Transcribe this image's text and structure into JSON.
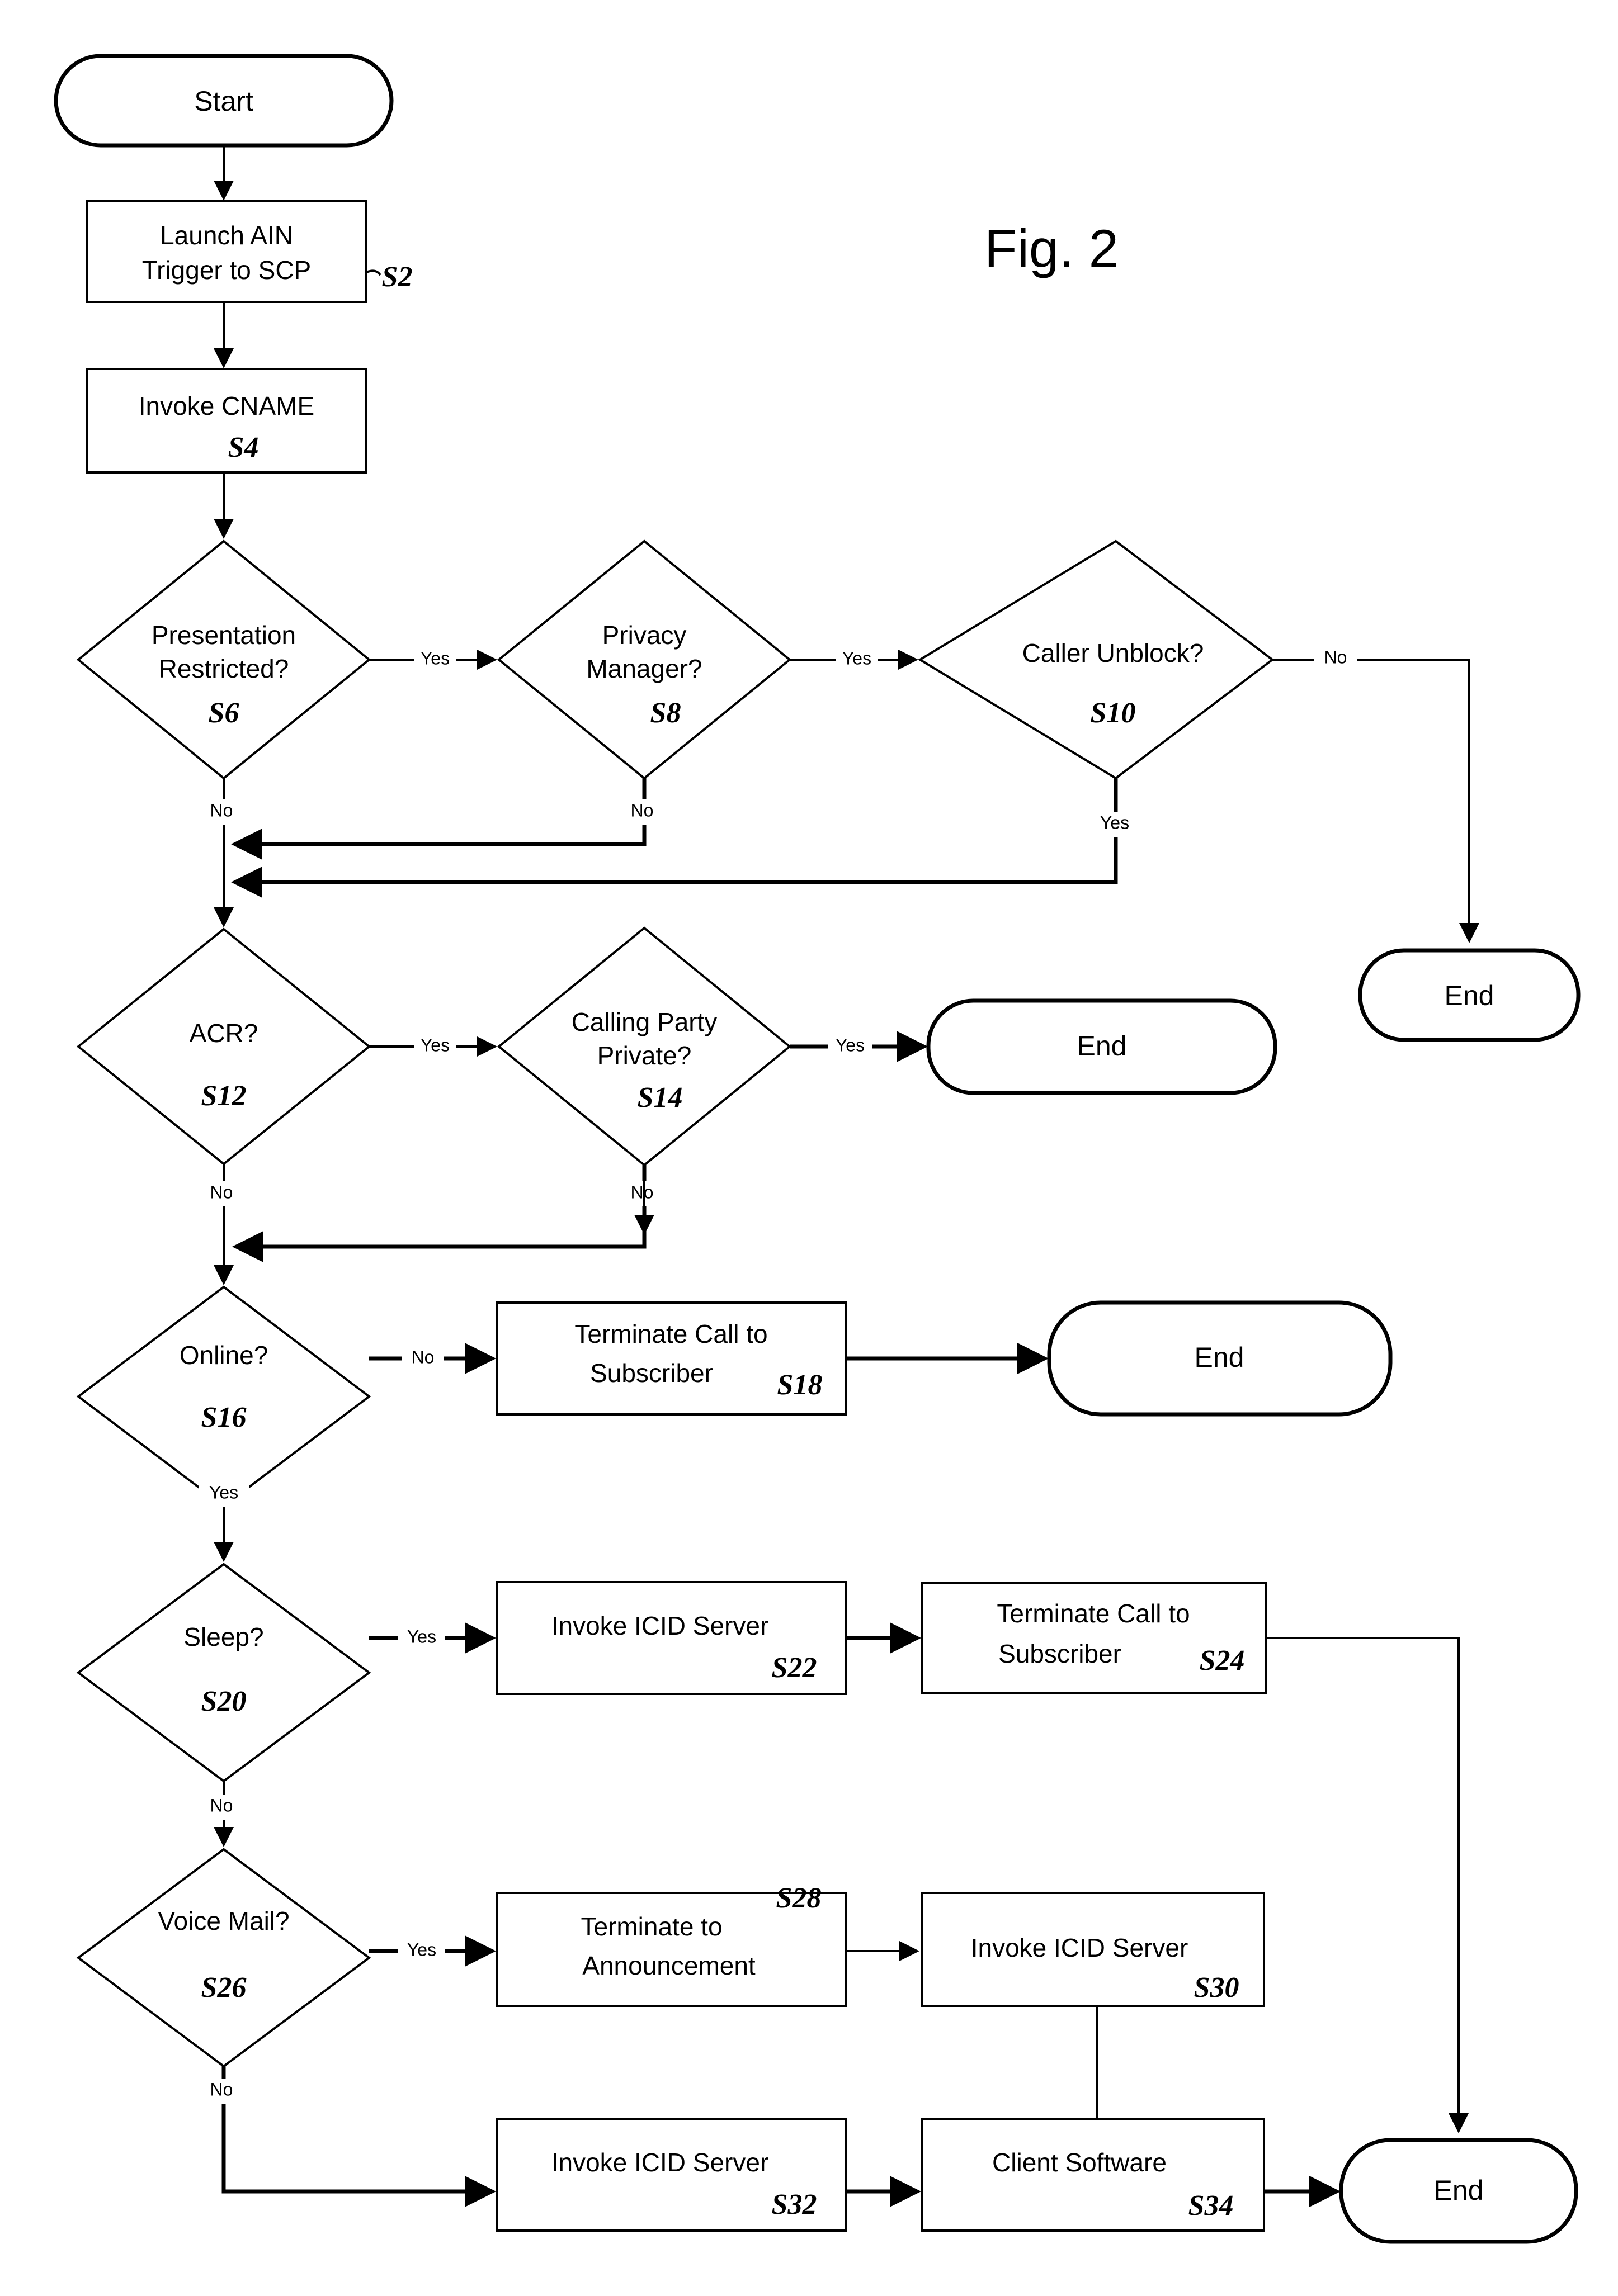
{
  "figure": {
    "title": "Fig. 2",
    "type": "patent-flowchart"
  },
  "nodes": {
    "start": {
      "label": "Start",
      "shape": "terminator",
      "ref": ""
    },
    "s2": {
      "label_line1": "Launch AIN",
      "label_line2": "Trigger to SCP",
      "shape": "process",
      "ref": "S2"
    },
    "s4": {
      "label_line1": "Invoke CNAME",
      "label_line2": "",
      "shape": "process",
      "ref": "S4"
    },
    "s6": {
      "label_line1": "Presentation",
      "label_line2": "Restricted?",
      "shape": "decision",
      "ref": "S6"
    },
    "s8": {
      "label_line1": "Privacy",
      "label_line2": "Manager?",
      "shape": "decision",
      "ref": "S8"
    },
    "s10": {
      "label_line1": "Caller Unblock?",
      "label_line2": "",
      "shape": "decision",
      "ref": "S10"
    },
    "s12": {
      "label_line1": "ACR?",
      "label_line2": "",
      "shape": "decision",
      "ref": "S12"
    },
    "s14": {
      "label_line1": "Calling Party",
      "label_line2": "Private?",
      "shape": "decision",
      "ref": "S14"
    },
    "s16": {
      "label_line1": "Online?",
      "label_line2": "",
      "shape": "decision",
      "ref": "S16"
    },
    "s18": {
      "label_line1": "Terminate Call to",
      "label_line2": "Subscriber",
      "shape": "process",
      "ref": "S18"
    },
    "s20": {
      "label_line1": "Sleep?",
      "label_line2": "",
      "shape": "decision",
      "ref": "S20"
    },
    "s22": {
      "label_line1": "Invoke ICID Server",
      "label_line2": "",
      "shape": "process",
      "ref": "S22"
    },
    "s24": {
      "label_line1": "Terminate Call to",
      "label_line2": "Subscriber",
      "shape": "process",
      "ref": "S24"
    },
    "s26": {
      "label_line1": "Voice Mail?",
      "label_line2": "",
      "shape": "decision",
      "ref": "S26"
    },
    "s28": {
      "label_line1": "Terminate to",
      "label_line2": "Announcement",
      "shape": "process",
      "ref": "S28"
    },
    "s30": {
      "label_line1": "Invoke ICID Server",
      "label_line2": "",
      "shape": "process",
      "ref": "S30"
    },
    "s32": {
      "label_line1": "Invoke ICID Server",
      "label_line2": "",
      "shape": "process",
      "ref": "S32"
    },
    "s34": {
      "label_line1": "Client Software",
      "label_line2": "",
      "shape": "process",
      "ref": "S34"
    },
    "end_unblock": {
      "label": "End",
      "shape": "terminator",
      "ref": ""
    },
    "end_acr": {
      "label": "End",
      "shape": "terminator",
      "ref": ""
    },
    "end_online": {
      "label": "End",
      "shape": "terminator",
      "ref": ""
    },
    "end_final": {
      "label": "End",
      "shape": "terminator",
      "ref": ""
    }
  },
  "edge_labels": {
    "s6_yes": "Yes",
    "s6_no": "No",
    "s8_yes": "Yes",
    "s8_no": "No",
    "s10_no": "No",
    "s10_yes": "Yes",
    "s12_yes": "Yes",
    "s12_no": "No",
    "s14_yes": "Yes",
    "s14_no": "No",
    "s16_no": "No",
    "s16_yes": "Yes",
    "s20_yes": "Yes",
    "s20_no": "No",
    "s26_yes": "Yes",
    "s26_no": "No"
  },
  "colors": {
    "stroke": "#000000",
    "fill": "#ffffff",
    "text": "#000000"
  }
}
